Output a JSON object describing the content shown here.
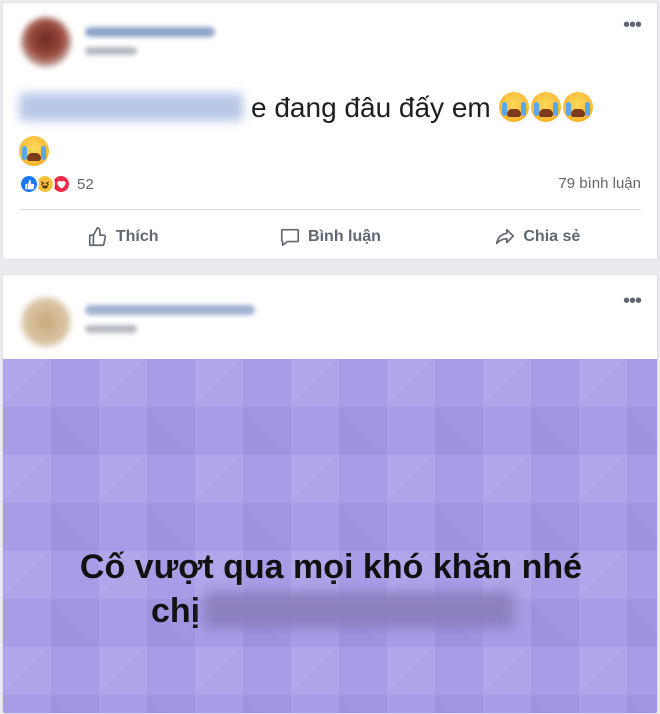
{
  "post1": {
    "emoji_name": "loudly-crying-face",
    "text_after_mention": "e đang đâu đấy em ",
    "emoji_count": 4,
    "reactions": {
      "icons": [
        "like-icon",
        "haha-icon",
        "love-icon"
      ],
      "count": "52"
    },
    "comment_count": "79 bình luận",
    "actions": {
      "like": "Thích",
      "comment": "Bình luận",
      "share": "Chia sẻ"
    }
  },
  "post2": {
    "card_line1": "Cố vượt qua mọi khó khăn nhé",
    "card_line2": "chị",
    "card_color": "#a99be6"
  },
  "colors": {
    "accent": "#1877f2",
    "love": "#f0284a",
    "page_bg": "#e9ebee"
  }
}
